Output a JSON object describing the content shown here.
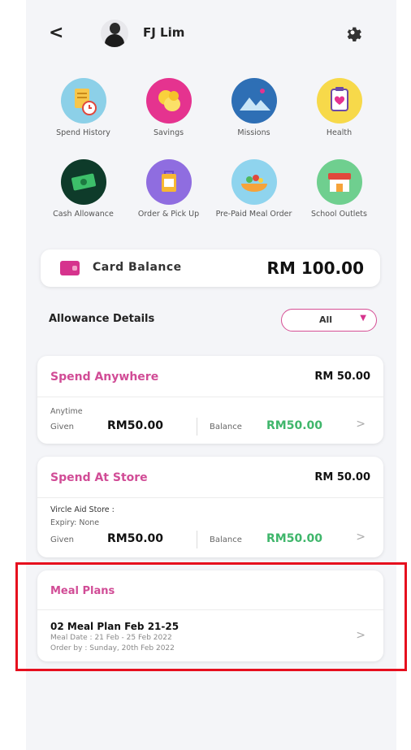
{
  "header": {
    "back_icon": "chevron-left-icon",
    "username": "FJ Lim",
    "settings_icon": "gear-icon"
  },
  "menu": [
    {
      "label": "Spend History",
      "icon": "receipt-clock-icon",
      "bg": "#8cd0e8"
    },
    {
      "label": "Savings",
      "icon": "coins-icon",
      "bg": "#e5338f"
    },
    {
      "label": "Missions",
      "icon": "mountain-icon",
      "bg": "#2e6fb5"
    },
    {
      "label": "Health",
      "icon": "clipboard-heart-icon",
      "bg": "#f7d94a"
    },
    {
      "label": "Cash Allowance",
      "icon": "cash-icon",
      "bg": "#0e3b2a"
    },
    {
      "label": "Order & Pick Up",
      "icon": "bag-icon",
      "bg": "#8f6de0"
    },
    {
      "label": "Pre-Paid Meal Order",
      "icon": "meal-bowl-icon",
      "bg": "#8fd4ee"
    },
    {
      "label": "School Outlets",
      "icon": "store-icon",
      "bg": "#6fcf8f"
    }
  ],
  "balance": {
    "label": "Card Balance",
    "amount": "RM 100.00"
  },
  "allowance": {
    "title": "Allowance Details",
    "filter": "All",
    "cards": [
      {
        "title": "Spend Anywhere",
        "amount": "RM 50.00",
        "line1": "Anytime",
        "line2": "",
        "given_label": "Given",
        "given": "RM50.00",
        "balance_label": "Balance",
        "balance": "RM50.00"
      },
      {
        "title": "Spend At Store",
        "amount": "RM 50.00",
        "line1": "Vircle Aid Store :",
        "line2": "Expiry: None",
        "given_label": "Given",
        "given": "RM50.00",
        "balance_label": "Balance",
        "balance": "RM50.00"
      }
    ]
  },
  "meal": {
    "title": "Meal Plans",
    "name": "02 Meal Plan Feb 21-25",
    "date": "Meal Date : 21 Feb - 25 Feb 2022",
    "order_by": "Order by : Sunday, 20th Feb 2022"
  },
  "colors": {
    "accent": "#d6338d",
    "balance_green": "#3fb66b",
    "highlight": "#e60f1e"
  }
}
